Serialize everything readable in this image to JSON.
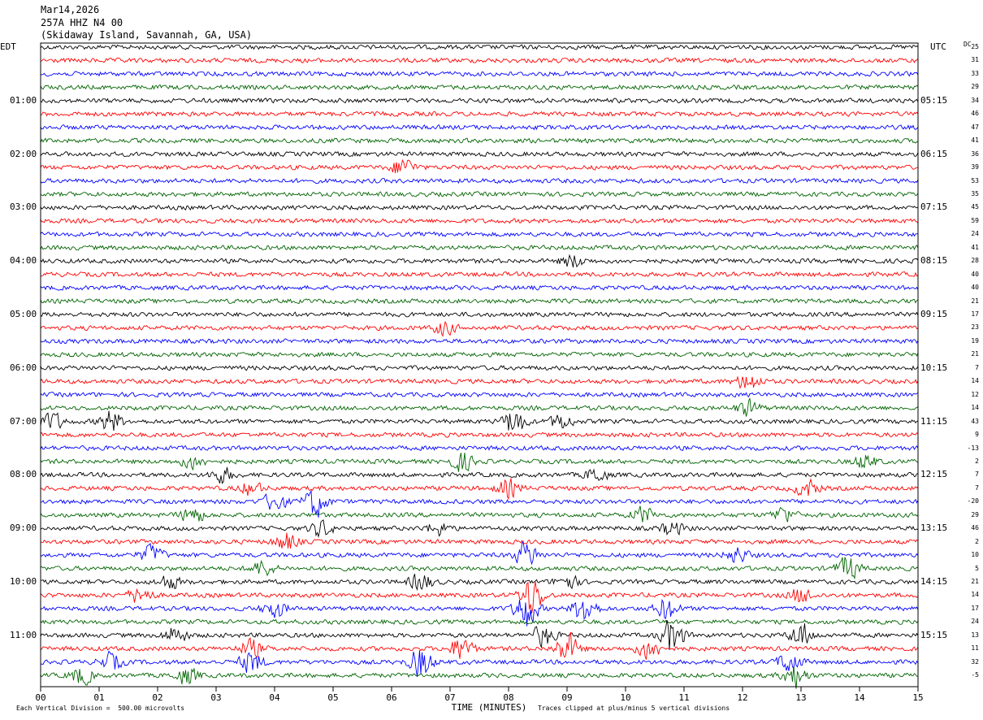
{
  "header": {
    "date": "Mar14,2026",
    "station": "257A HHZ N4 00",
    "location": "(Skidaway Island, Savannah, GA, USA)"
  },
  "tz_left": "EDT",
  "tz_right": "UTC",
  "dc_header": "DC",
  "left_labels": [
    "01:00",
    "02:00",
    "03:00",
    "04:00",
    "05:00",
    "06:00",
    "07:00",
    "08:00",
    "09:00",
    "10:00",
    "11:00"
  ],
  "right_labels": [
    "05:15",
    "06:15",
    "07:15",
    "08:15",
    "09:15",
    "10:15",
    "11:15",
    "12:15",
    "13:15",
    "14:15",
    "15:15"
  ],
  "dc_offsets": [
    "25",
    "31",
    "33",
    "29",
    "34",
    "46",
    "47",
    "41",
    "36",
    "39",
    "53",
    "35",
    "45",
    "59",
    "24",
    "41",
    "28",
    "40",
    "40",
    "21",
    "17",
    "23",
    "19",
    "21",
    "7",
    "14",
    "12",
    "14",
    "43",
    "9",
    "-13",
    "2",
    "7",
    "7",
    "-20",
    "29",
    "46",
    "2",
    "10",
    "5",
    "21",
    "14",
    "17",
    "24",
    "13",
    "11",
    "32",
    "-5"
  ],
  "footer": {
    "division": "Each Vertical Division =  500.00 microvolts",
    "clipped": "Traces clipped at plus/minus 5 vertical divisions"
  },
  "colors": {
    "trace_cycle": [
      "#000000",
      "#ff0000",
      "#0000ff",
      "#006400"
    ]
  },
  "chart_data": {
    "type": "line",
    "title": "Mar14,2026 257A HHZ N4 00 (Skidaway Island, Savannah, GA, USA)",
    "xlabel": "TIME (MINUTES)",
    "ylabel": "",
    "xlim": [
      0,
      15
    ],
    "x_ticks": [
      "00",
      "01",
      "02",
      "03",
      "04",
      "05",
      "06",
      "07",
      "08",
      "09",
      "10",
      "11",
      "12",
      "13",
      "14",
      "15"
    ],
    "trace_count": 48,
    "trace_interval_minutes": 15,
    "grid": false,
    "events": [
      {
        "trace": 9,
        "minute": 6.2,
        "amp": 2.2
      },
      {
        "trace": 16,
        "minute": 9.1,
        "amp": 1.5
      },
      {
        "trace": 21,
        "minute": 6.9,
        "amp": 1.5
      },
      {
        "trace": 25,
        "minute": 12.1,
        "amp": 2.2
      },
      {
        "trace": 27,
        "minute": 12.1,
        "amp": 1.8
      },
      {
        "trace": 28,
        "minute": 0.2,
        "amp": 2.0
      },
      {
        "trace": 28,
        "minute": 1.2,
        "amp": 2.5
      },
      {
        "trace": 28,
        "minute": 8.1,
        "amp": 3.0
      },
      {
        "trace": 28,
        "minute": 8.9,
        "amp": 1.8
      },
      {
        "trace": 31,
        "minute": 2.6,
        "amp": 1.6
      },
      {
        "trace": 31,
        "minute": 7.2,
        "amp": 2.2
      },
      {
        "trace": 31,
        "minute": 14.1,
        "amp": 1.6
      },
      {
        "trace": 32,
        "minute": 3.1,
        "amp": 1.8
      },
      {
        "trace": 32,
        "minute": 9.5,
        "amp": 1.6
      },
      {
        "trace": 33,
        "minute": 3.6,
        "amp": 1.5
      },
      {
        "trace": 33,
        "minute": 8.0,
        "amp": 2.0
      },
      {
        "trace": 33,
        "minute": 13.1,
        "amp": 2.0
      },
      {
        "trace": 34,
        "minute": 4.0,
        "amp": 2.2
      },
      {
        "trace": 34,
        "minute": 4.7,
        "amp": 3.5
      },
      {
        "trace": 35,
        "minute": 2.6,
        "amp": 2.0
      },
      {
        "trace": 35,
        "minute": 10.3,
        "amp": 1.8
      },
      {
        "trace": 35,
        "minute": 12.7,
        "amp": 1.8
      },
      {
        "trace": 36,
        "minute": 4.8,
        "amp": 1.8
      },
      {
        "trace": 36,
        "minute": 6.8,
        "amp": 1.5
      },
      {
        "trace": 36,
        "minute": 10.8,
        "amp": 1.5
      },
      {
        "trace": 37,
        "minute": 4.2,
        "amp": 2.0
      },
      {
        "trace": 38,
        "minute": 1.9,
        "amp": 2.2
      },
      {
        "trace": 38,
        "minute": 8.3,
        "amp": 3.0
      },
      {
        "trace": 38,
        "minute": 11.9,
        "amp": 1.8
      },
      {
        "trace": 39,
        "minute": 3.8,
        "amp": 1.8
      },
      {
        "trace": 39,
        "minute": 13.8,
        "amp": 2.8
      },
      {
        "trace": 40,
        "minute": 2.2,
        "amp": 1.6
      },
      {
        "trace": 40,
        "minute": 6.5,
        "amp": 2.0
      },
      {
        "trace": 40,
        "minute": 9.0,
        "amp": 1.6
      },
      {
        "trace": 41,
        "minute": 1.7,
        "amp": 2.0
      },
      {
        "trace": 41,
        "minute": 8.4,
        "amp": 4.5
      },
      {
        "trace": 41,
        "minute": 13.0,
        "amp": 1.8
      },
      {
        "trace": 42,
        "minute": 4.0,
        "amp": 2.0
      },
      {
        "trace": 42,
        "minute": 8.3,
        "amp": 4.5
      },
      {
        "trace": 42,
        "minute": 9.3,
        "amp": 3.5
      },
      {
        "trace": 42,
        "minute": 10.7,
        "amp": 2.5
      },
      {
        "trace": 44,
        "minute": 2.3,
        "amp": 2.0
      },
      {
        "trace": 44,
        "minute": 8.6,
        "amp": 2.5
      },
      {
        "trace": 44,
        "minute": 10.8,
        "amp": 4.0
      },
      {
        "trace": 44,
        "minute": 13.0,
        "amp": 2.8
      },
      {
        "trace": 45,
        "minute": 3.6,
        "amp": 2.0
      },
      {
        "trace": 45,
        "minute": 7.2,
        "amp": 2.8
      },
      {
        "trace": 45,
        "minute": 9.0,
        "amp": 3.5
      },
      {
        "trace": 45,
        "minute": 10.4,
        "amp": 2.5
      },
      {
        "trace": 46,
        "minute": 1.2,
        "amp": 2.0
      },
      {
        "trace": 46,
        "minute": 3.6,
        "amp": 2.5
      },
      {
        "trace": 46,
        "minute": 6.5,
        "amp": 3.5
      },
      {
        "trace": 46,
        "minute": 12.8,
        "amp": 2.5
      },
      {
        "trace": 47,
        "minute": 0.7,
        "amp": 2.0
      },
      {
        "trace": 47,
        "minute": 2.5,
        "amp": 2.0
      },
      {
        "trace": 47,
        "minute": 12.9,
        "amp": 2.8
      }
    ]
  }
}
